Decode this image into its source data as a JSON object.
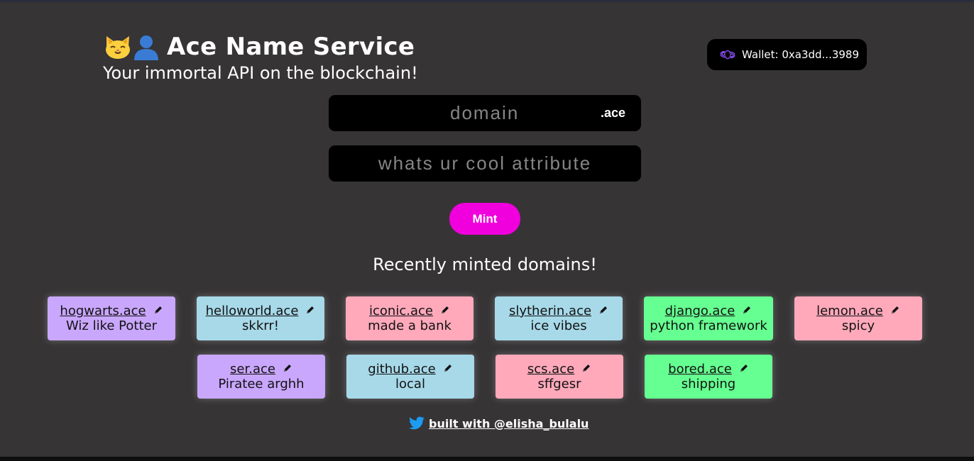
{
  "header": {
    "title": "Ace Name Service",
    "subtitle": "Your immortal API on the blockchain!",
    "emoji_icons": [
      "cat-face-icon",
      "user-silhouette-icon"
    ]
  },
  "wallet": {
    "label": "Wallet: 0xa3dd...3989",
    "icon": "polygon-icon",
    "icon_color": "#8247e5"
  },
  "form": {
    "domain_placeholder": "domain",
    "domain_suffix": ".ace",
    "attribute_placeholder": "whats ur cool attribute",
    "mint_label": "Mint"
  },
  "recent": {
    "title": "Recently minted domains!",
    "domains": [
      {
        "name": "hogwarts.ace",
        "attribute": "Wiz like Potter",
        "color": "#c9a7fd"
      },
      {
        "name": "helloworld.ace",
        "attribute": "skkrr!",
        "color": "#a7d9e9"
      },
      {
        "name": "iconic.ace",
        "attribute": "made a bank",
        "color": "#ffa9bb"
      },
      {
        "name": "slytherin.ace",
        "attribute": "ice vibes",
        "color": "#a7d9e9"
      },
      {
        "name": "django.ace",
        "attribute": "python framework",
        "color": "#66ff91"
      },
      {
        "name": "lemon.ace",
        "attribute": "spicy",
        "color": "#ffa9bb"
      },
      {
        "name": "ser.ace",
        "attribute": "Piratee arghh",
        "color": "#c9a7fd"
      },
      {
        "name": "github.ace",
        "attribute": "local",
        "color": "#a7d9e9"
      },
      {
        "name": "scs.ace",
        "attribute": "sffgesr",
        "color": "#ffa9bb"
      },
      {
        "name": "bored.ace",
        "attribute": "shipping",
        "color": "#66ff91"
      }
    ]
  },
  "footer": {
    "link_text": "built with @elisha_bulalu",
    "icon": "twitter-icon",
    "icon_color": "#1d9bf0"
  },
  "colors": {
    "background": "#363435",
    "mint_button": "#f000dc",
    "field_background": "#000000"
  }
}
